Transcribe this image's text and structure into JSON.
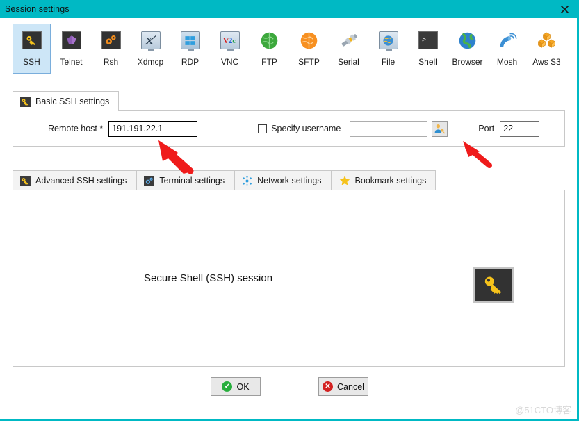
{
  "window": {
    "title": "Session settings",
    "close_label": "✕",
    "titlebar_color": "#00b9c4"
  },
  "protocols": [
    {
      "label": "SSH",
      "icon": "ssh-key-icon",
      "selected": true
    },
    {
      "label": "Telnet",
      "icon": "telnet-icon",
      "selected": false
    },
    {
      "label": "Rsh",
      "icon": "rsh-gears-icon",
      "selected": false
    },
    {
      "label": "Xdmcp",
      "icon": "xdmcp-icon",
      "selected": false
    },
    {
      "label": "RDP",
      "icon": "rdp-windows-icon",
      "selected": false
    },
    {
      "label": "VNC",
      "icon": "vnc-icon",
      "selected": false
    },
    {
      "label": "FTP",
      "icon": "ftp-globe-icon",
      "selected": false
    },
    {
      "label": "SFTP",
      "icon": "sftp-globe-icon",
      "selected": false
    },
    {
      "label": "Serial",
      "icon": "serial-plug-icon",
      "selected": false
    },
    {
      "label": "File",
      "icon": "file-share-icon",
      "selected": false
    },
    {
      "label": "Shell",
      "icon": "shell-prompt-icon",
      "selected": false
    },
    {
      "label": "Browser",
      "icon": "browser-globe-icon",
      "selected": false
    },
    {
      "label": "Mosh",
      "icon": "mosh-dish-icon",
      "selected": false
    },
    {
      "label": "Aws S3",
      "icon": "aws-s3-icon",
      "selected": false
    }
  ],
  "basic_tab": {
    "label": "Basic SSH settings",
    "icon": "key-icon",
    "remote_host_label": "Remote host *",
    "remote_host_value": "191.191.22.1",
    "specify_username_label": "Specify username",
    "specify_username_checked": false,
    "username_value": "",
    "username_placeholder": "",
    "user_picker_icon": "user-key-icon",
    "port_label": "Port",
    "port_value": "22"
  },
  "lower_tabs": [
    {
      "label": "Advanced SSH settings",
      "icon": "key-icon",
      "active": false
    },
    {
      "label": "Terminal settings",
      "icon": "gear-icon",
      "active": false
    },
    {
      "label": "Network settings",
      "icon": "network-icon",
      "active": false
    },
    {
      "label": "Bookmark settings",
      "icon": "star-icon",
      "active": false
    }
  ],
  "content": {
    "session_text": "Secure Shell (SSH) session",
    "big_icon": "key-icon"
  },
  "buttons": {
    "ok_label": "OK",
    "ok_icon": "check-circle-icon",
    "cancel_label": "Cancel",
    "cancel_icon": "x-circle-icon"
  },
  "annotations": {
    "arrow_color": "#ef1b1b",
    "arrow_count": 2
  },
  "watermark": "@51CTO博客"
}
